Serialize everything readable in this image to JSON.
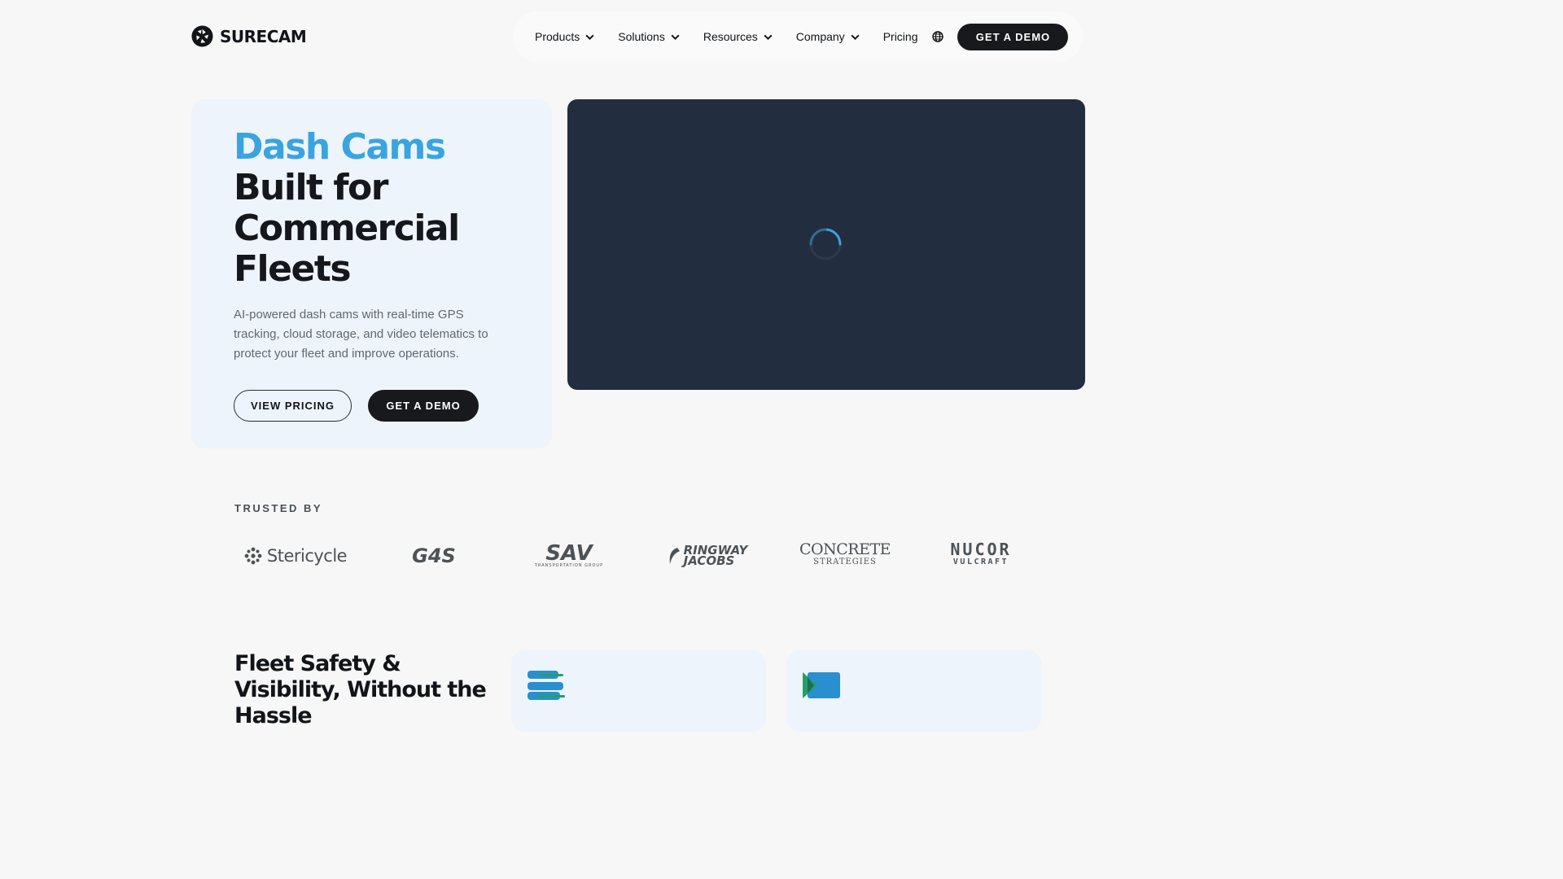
{
  "header": {
    "logo_text": "SURECAM",
    "logo_icon": "camera-shutter-icon",
    "nav": [
      {
        "label": "Products",
        "has_dropdown": true
      },
      {
        "label": "Solutions",
        "has_dropdown": true
      },
      {
        "label": "Resources",
        "has_dropdown": true
      },
      {
        "label": "Company",
        "has_dropdown": true
      },
      {
        "label": "Pricing",
        "has_dropdown": false
      }
    ],
    "language_icon": "globe-icon",
    "cta_label": "GET A DEMO"
  },
  "hero": {
    "title_accent": "Dash Cams",
    "title_line1": "Built for",
    "title_line2": "Commercial",
    "title_line3": "Fleets",
    "description": "AI-powered dash cams with real-time GPS tracking, cloud storage, and video telematics to protect your fleet and improve operations.",
    "secondary_cta": "VIEW PRICING",
    "primary_cta": "GET A DEMO",
    "accent_color": "#3aa4e0"
  },
  "video": {
    "state_icon": "loading-spinner-icon",
    "background_color": "#222d3f"
  },
  "trusted": {
    "label": "TRUSTED BY",
    "logos": [
      {
        "name": "Stericycle"
      },
      {
        "name": "G4S"
      },
      {
        "name": "SAV",
        "sub": "TRANSPORTATION GROUP"
      },
      {
        "name": "RINGWAY",
        "sub": "JACOBS"
      },
      {
        "name": "CONCRETE",
        "sub": "STRATEGIES"
      },
      {
        "name": "NUCOR",
        "sub": "VULCRAFT"
      }
    ]
  },
  "features": {
    "title": "Fleet Safety & Visibility, Without the Hassle",
    "cards": [
      {
        "icon": "stacked-bars-icon"
      },
      {
        "icon": "video-play-icon"
      }
    ]
  }
}
